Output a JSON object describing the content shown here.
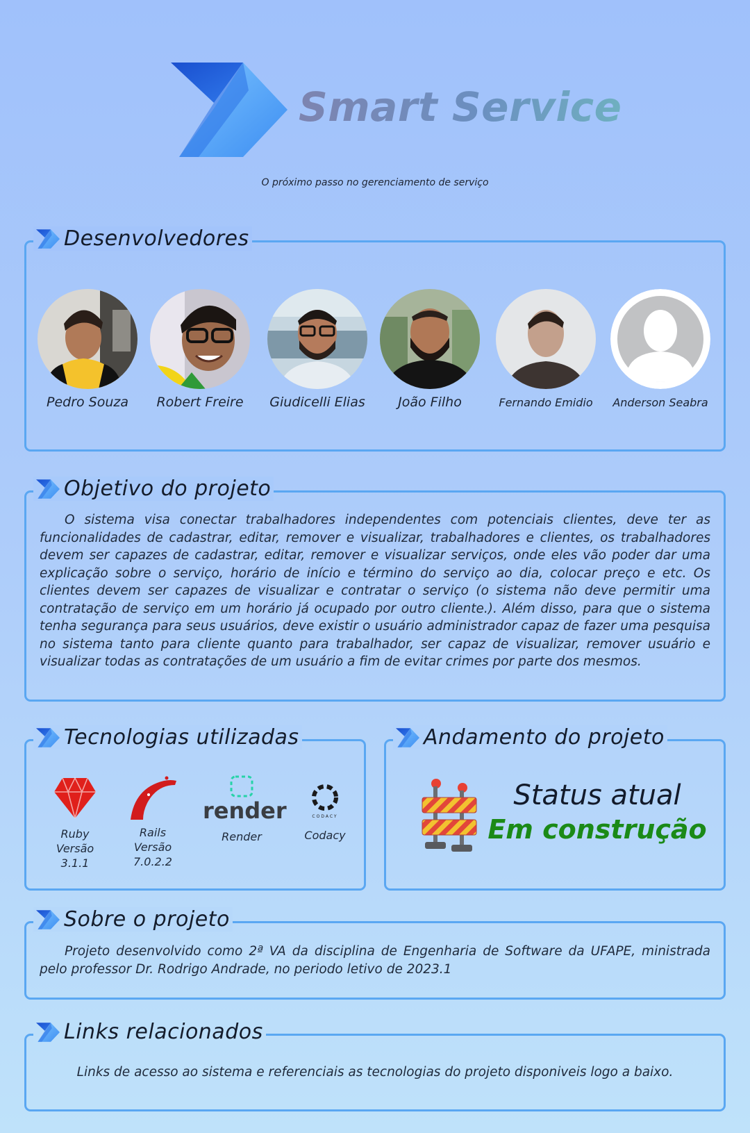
{
  "header": {
    "title": "Smart Service",
    "tagline": "O próximo passo no gerenciamento de serviço",
    "logo_icon": "power-automate-chevron-icon"
  },
  "sections": {
    "developers": {
      "heading": "Desenvolvedores",
      "members": [
        {
          "name": "Pedro Souza"
        },
        {
          "name": "Robert Freire"
        },
        {
          "name": "Giudicelli Elias"
        },
        {
          "name": "João Filho"
        },
        {
          "name": "Fernando Emidio"
        },
        {
          "name": "Anderson Seabra"
        }
      ]
    },
    "objective": {
      "heading": "Objetivo do projeto",
      "text": "O sistema visa conectar trabalhadores independentes com potenciais clientes, deve ter as funcionalidades de cadastrar, editar, remover e visualizar, trabalhadores e clientes, os trabalhadores devem ser capazes de cadastrar, editar, remover e visualizar serviços, onde eles vão poder dar uma explicação sobre o serviço, horário de início e término do serviço ao dia, colocar preço e etc. Os clientes devem ser capazes de visualizar e contratar o serviço (o sistema não deve permitir uma contratação de serviço em um horário já ocupado por outro cliente.). Além disso, para que o sistema tenha segurança para seus usuários, deve existir o usuário administrador capaz de fazer uma pesquisa no sistema tanto para cliente quanto para trabalhador, ser capaz de visualizar, remover usuário e visualizar todas as contratações de um usuário a fim de evitar crimes por parte dos mesmos."
    },
    "technologies": {
      "heading": "Tecnologias utilizadas",
      "items": [
        {
          "name": "Ruby",
          "version": "Versão 3.1.1",
          "icon": "ruby-gem-icon"
        },
        {
          "name": "Rails",
          "version": "Versão 7.0.2.2",
          "icon": "rails-icon"
        },
        {
          "name": "Render",
          "version": "",
          "icon": "render-logo-icon",
          "logo_text": "render"
        },
        {
          "name": "Codacy",
          "version": "",
          "icon": "codacy-logo-icon",
          "logo_text": "CODACY"
        }
      ]
    },
    "progress": {
      "heading": "Andamento do projeto",
      "status_label": "Status atual",
      "status_value": "Em construção",
      "status_color": "#1b8a17",
      "icon": "construction-barrier-icon"
    },
    "about": {
      "heading": "Sobre o projeto",
      "text": "Projeto desenvolvido como 2ª VA da disciplina de Engenharia de Software da UFAPE, ministrada pelo professor Dr. Rodrigo Andrade, no periodo letivo de 2023.1"
    },
    "links": {
      "heading": "Links relacionados",
      "text": "Links de acesso ao sistema e referenciais as tecnologias do projeto disponiveis logo a baixo."
    }
  },
  "colors": {
    "border": "#5aa7f2",
    "logo_dark": "#1f5fd6",
    "logo_light": "#66b7fb"
  }
}
